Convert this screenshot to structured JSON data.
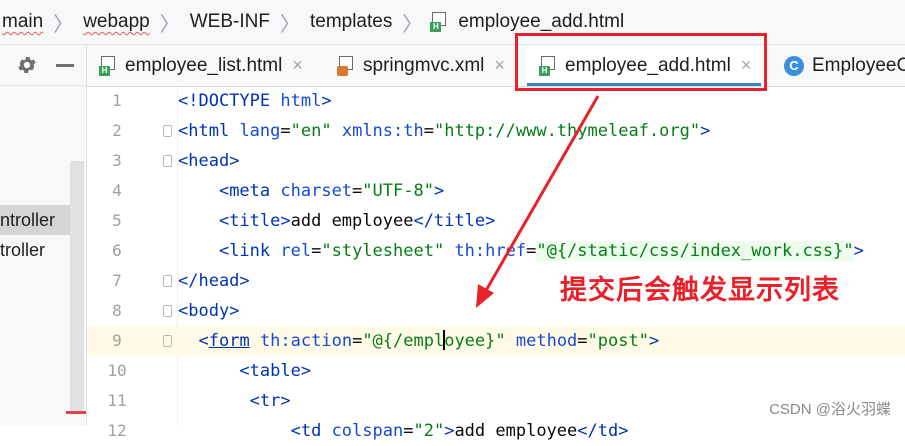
{
  "breadcrumb": [
    {
      "label": "main",
      "wavy": true
    },
    {
      "label": "webapp",
      "wavy": true
    },
    {
      "label": "WEB-INF",
      "wavy": false
    },
    {
      "label": "templates",
      "wavy": false
    },
    {
      "label": "employee_add.html",
      "wavy": false,
      "icon": "html-file-icon"
    }
  ],
  "left_panel": {
    "items": [
      "ntroller",
      "troller"
    ]
  },
  "tabs": [
    {
      "label": "employee_list.html",
      "icon": "html-file-icon",
      "active": false
    },
    {
      "label": "springmvc.xml",
      "icon": "xml-file-icon",
      "active": false
    },
    {
      "label": "employee_add.html",
      "icon": "html-file-icon",
      "active": true
    },
    {
      "label": "EmployeeC",
      "icon": "class-icon",
      "active": false
    }
  ],
  "tab_close_glyph": "×",
  "editor": {
    "line_numbers": [
      "1",
      "2",
      "3",
      "4",
      "5",
      "6",
      "7",
      "8",
      "9",
      "10",
      "11",
      "12"
    ],
    "lines": [
      "<!DOCTYPE html>",
      "<html lang=\"en\" xmlns:th=\"http://www.thymeleaf.org\">",
      "<head>",
      "    <meta charset=\"UTF-8\">",
      "    <title>add employee</title>",
      "    <link rel=\"stylesheet\" th:href=\"@{/static/css/index_work.css}\">",
      "</head>",
      "<body>",
      "  <form th:action=\"@{/employee}\" method=\"post\">",
      "      <table>",
      "       <tr>",
      "           <td colspan=\"2\">add employee</td>"
    ],
    "highlighted_line": 9
  },
  "annotation": {
    "text": "提交后会触发显示列表",
    "color": "#e8222a"
  },
  "watermark": "CSDN @浴火羽蝶"
}
